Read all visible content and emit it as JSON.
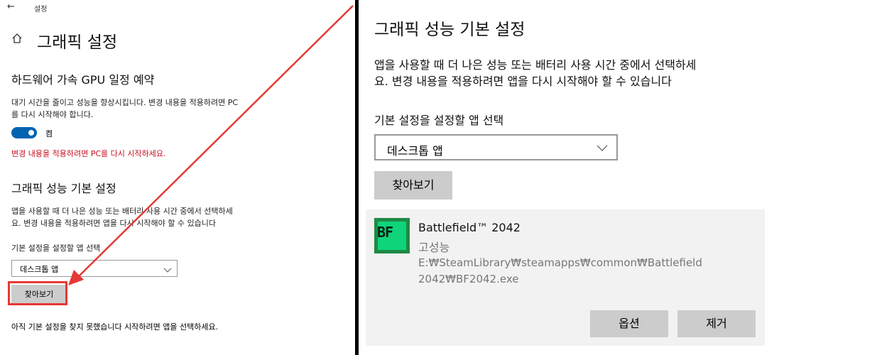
{
  "left": {
    "titlebar": "설정",
    "page_title": "그래픽 설정",
    "hw_section": {
      "title": "하드웨어 가속 GPU 일정 예약",
      "desc_line1": "대기 시간을 줄이고 성능을 향상시킵니다. 변경 내용을 적용하려면 PC",
      "desc_line2": "를 다시 시작해야 합니다.",
      "toggle_label": "켬",
      "toggle_on": true,
      "warning": "변경 내용을 적용하려면 PC를 다시 시작하세요."
    },
    "pref_section": {
      "title": "그래픽 성능 기본 설정",
      "desc_line1": "앱을 사용할 때 더 나은 성능 또는 배터리 사용 시간 중에서 선택하세",
      "desc_line2": "요. 변경 내용을 적용하려면 앱을 다시 시작해야 할 수 있습니다",
      "select_label": "기본 설정을 설정할 앱 선택",
      "select_value": "데스크톱 앱",
      "browse_label": "찾아보기",
      "note": "아직 기본 설정을 찾지 못했습니다 시작하려면 앱을 선택하세요."
    }
  },
  "right": {
    "title": "그래픽 성능 기본 설정",
    "desc_line1": "앱을 사용할 때 더 나은 성능 또는 배터리 사용 시간 중에서 선택하세",
    "desc_line2": "요. 변경 내용을 적용하려면 앱을 다시 시작해야 할 수 있습니다",
    "select_label": "기본 설정을 설정할 앱 선택",
    "select_value": "데스크톱 앱",
    "browse_label": "찾아보기",
    "app": {
      "icon_text": "BF",
      "name": "Battlefield™ 2042",
      "mode": "고성능",
      "path_line1": "E:₩SteamLibrary₩steamapps₩common₩Battlefield",
      "path_line2": "2042₩BF2042.exe",
      "options_label": "옵션",
      "remove_label": "제거"
    }
  },
  "colors": {
    "accent": "#0063b1",
    "warning": "#c50f1f",
    "annotation": "#e53935",
    "button_bg": "#cccccc"
  }
}
